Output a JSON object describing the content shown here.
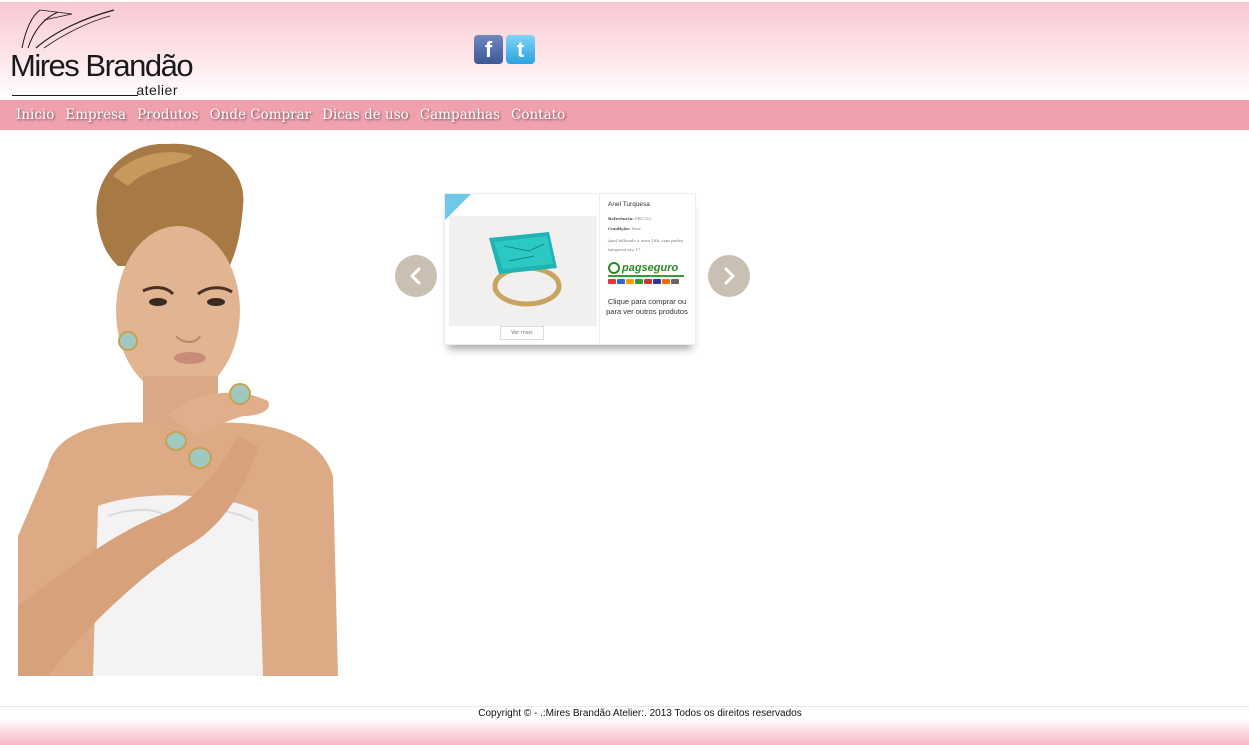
{
  "brand": {
    "name": "Mires Brandão",
    "subtitle": "atelier"
  },
  "social": [
    {
      "icon": "facebook-icon",
      "glyph": "f",
      "color": "#3b5998"
    },
    {
      "icon": "twitter-icon",
      "glyph": "t",
      "color": "#2aa3df"
    }
  ],
  "nav": {
    "items": [
      "Inicio",
      "Empresa",
      "Produtos",
      "Onde Comprar",
      "Dicas de uso",
      "Campanhas",
      "Contato"
    ]
  },
  "product": {
    "name": "Anel Turquesa",
    "reference_label": "Referência:",
    "reference_value": "PR1720",
    "condition_label": "Condição:",
    "condition_value": "New",
    "description": "Anel folheado a ouro 18k, com pedra turquesa aro 17",
    "more_label": "Ver mais",
    "payment_brand": "pagseguro",
    "cta": "Clique para comprar ou para ver outros produtos"
  },
  "footer": {
    "copyright": "Copyright © - .:Mires Brandão Atelier:. 2013 Todos os direitos reservados"
  },
  "colors": {
    "nav_bg": "#efa2ae",
    "header_pink": "#f8c8d2",
    "arrow_bg": "#c9bfb3",
    "ribbon": "#6fc7ea"
  }
}
